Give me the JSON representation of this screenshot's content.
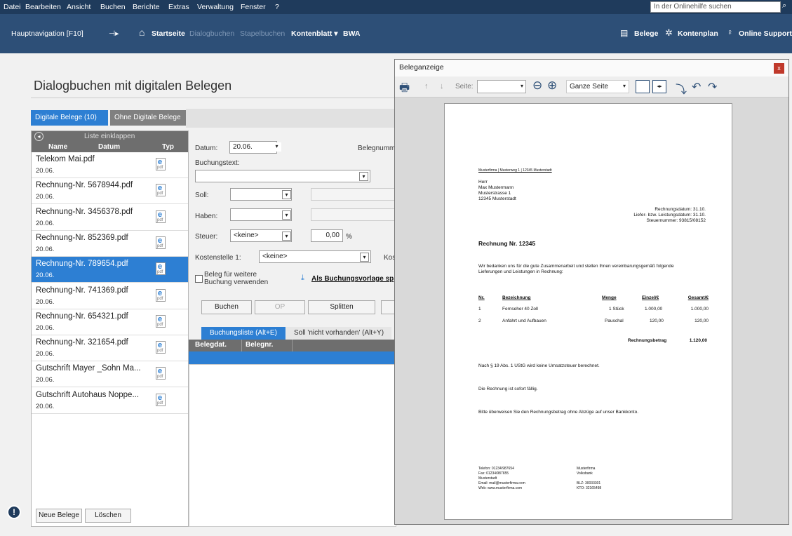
{
  "menu": {
    "items": [
      "Datei",
      "Bearbeiten",
      "Ansicht",
      "Buchen",
      "Berichte",
      "Extras",
      "Verwaltung",
      "Fenster",
      "?"
    ],
    "help_placeholder": "In der Onlinehilfe suchen"
  },
  "nav": {
    "hauptnavigation": "Hauptnavigation [F10]",
    "startseite": "Startseite",
    "dialogbuchen": "Dialogbuchen",
    "stapelbuchen": "Stapelbuchen",
    "kontenblatt": "Kontenblatt ▾",
    "bwa": "BWA",
    "belege": "Belege",
    "kontenplan": "Kontenplan",
    "support": "Online Support"
  },
  "page": {
    "title": "Dialogbuchen mit digitalen Belegen"
  },
  "tabs": {
    "digital": "Digitale Belege (10)",
    "ohne": "Ohne Digitale Belege"
  },
  "list": {
    "collapse": "Liste einklappen",
    "col_name": "Name",
    "col_datum": "Datum",
    "col_typ": "Typ",
    "items": [
      {
        "name": "Telekom Mai.pdf",
        "date": "20.06."
      },
      {
        "name": "Rechnung-Nr. 5678944.pdf",
        "date": "20.06."
      },
      {
        "name": "Rechnung-Nr. 3456378.pdf",
        "date": "20.06."
      },
      {
        "name": "Rechnung-Nr. 852369.pdf",
        "date": "20.06."
      },
      {
        "name": "Rechnung-Nr. 789654.pdf",
        "date": "20.06."
      },
      {
        "name": "Rechnung-Nr. 741369.pdf",
        "date": "20.06."
      },
      {
        "name": "Rechnung-Nr. 654321.pdf",
        "date": "20.06."
      },
      {
        "name": "Rechnung-Nr. 321654.pdf",
        "date": "20.06."
      },
      {
        "name": "Gutschrift Mayer _Sohn Ma...",
        "date": "20.06."
      },
      {
        "name": "Gutschrift Autohaus Noppe...",
        "date": "20.06."
      }
    ],
    "selected_index": 4,
    "neue_belege": "Neue Belege",
    "loeschen": "Löschen"
  },
  "form": {
    "datum_label": "Datum:",
    "datum_value": "20.06.",
    "belegnummer_label": "Belegnumme",
    "buchungstext_label": "Buchungstext:",
    "soll_label": "Soll:",
    "haben_label": "Haben:",
    "steuer_label": "Steuer:",
    "steuer_value": "<keine>",
    "steuer_pct": "0,00",
    "pct": "%",
    "kostenstelle_label": "Kostenstelle 1:",
    "kostenstelle_value": "<keine>",
    "kos": "Kos",
    "beleg_check": "Beleg für weitere\nBuchung verwenden",
    "vorlage": "Als Buchungsvorlage sp",
    "buchen": "Buchen",
    "op": "OP",
    "splitten": "Splitten"
  },
  "bottom": {
    "tab1": "Buchungsliste (Alt+E)",
    "tab2": "Soll 'nicht vorhanden' (Alt+Y)",
    "col1": "Belegdat.",
    "col2": "Belegnr."
  },
  "viewer": {
    "title": "Beleganzeige",
    "close": "x",
    "seite": "Seite:",
    "zoom": "Ganze Seite",
    "doc": {
      "sender": "Musterfirma | Musterweg 1 | 12345 Musterstadt",
      "addr": [
        "Herr",
        "Max Mustermann",
        "Musterstrasse 1",
        "12345 Musterstadt"
      ],
      "meta": [
        "Rechnungsdatum:  31.10.",
        "Liefer- bzw. Leistungsdatum:  31.10.",
        "Steuernummer:  93815/08152"
      ],
      "title": "Rechnung Nr. 12345",
      "intro1": "Wir bedanken uns für die gute Zusammenarbeit und stellen Ihnen vereinbarungsgemäß folgende",
      "intro2": "Lieferungen und Leistungen in Rechnung:",
      "th": [
        "Nr.",
        "Bezeichnung",
        "Menge",
        "Einzel/€",
        "Gesamt/€"
      ],
      "rows": [
        [
          "1",
          "Fernseher 40 Zoll",
          "1 Stück",
          "1.000,00",
          "1.000,00"
        ],
        [
          "2",
          "Anfahrt und Aufbauen",
          "Pauschal",
          "120,00",
          "120,00"
        ]
      ],
      "total_label": "Rechnungsbetrag",
      "total": "1.120,00",
      "note1": "Nach § 19 Abs. 1 UStG wird keine Umsatzsteuer berechnet.",
      "note2": "Die Rechnung ist sofort fällig.",
      "note3": "Bitte überweisen Sie den Rechnungsbetrag ohne Abzüge auf unser Bankkonto.",
      "footer_left": [
        "Telefon:    01234/987654",
        "Fax:          01234/987655",
        "Musterstadt",
        "Email:       mail@musterfirma.com",
        "Web:         www.musterfirma.com"
      ],
      "footer_right": [
        "Musterfirma",
        "Volksbank",
        "",
        "BLZ: 30033301",
        "KTO: 32165498"
      ]
    }
  }
}
